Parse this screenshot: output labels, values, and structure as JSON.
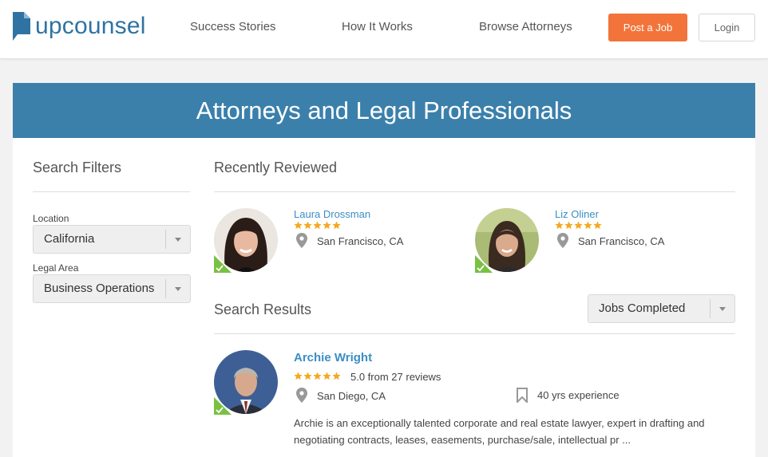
{
  "brand": {
    "name": "upcounsel",
    "color": "#2f73a2",
    "accent": "#f2743b"
  },
  "nav": {
    "links": [
      "Success Stories",
      "How It Works",
      "Browse Attorneys"
    ],
    "post_job": "Post a Job",
    "login": "Login"
  },
  "banner": {
    "title": "Attorneys and Legal Professionals",
    "color": "#3b80ab"
  },
  "filters": {
    "title": "Search Filters",
    "location_label": "Location",
    "location_value": "California",
    "legal_area_label": "Legal Area",
    "legal_area_value": "Business Operations"
  },
  "recently_reviewed": {
    "title": "Recently Reviewed",
    "people": [
      {
        "name": "Laura Drossman",
        "rating": 5,
        "location": "San Francisco, CA"
      },
      {
        "name": "Liz Oliner",
        "rating": 5,
        "location": "San Francisco, CA"
      }
    ]
  },
  "results": {
    "title": "Search Results",
    "sort_value": "Jobs Completed",
    "items": [
      {
        "name": "Archie Wright",
        "rating": 5,
        "reviews": "5.0 from 27 reviews",
        "location": "San Diego, CA",
        "experience": "40 yrs experience",
        "description": "Archie is an exceptionally talented corporate and real estate lawyer, expert in drafting and negotiating contracts, leases, easements, purchase/sale, intellectual pr ..."
      }
    ]
  },
  "icons": [
    "logo-icon",
    "star-icon",
    "location-pin-icon",
    "bookmark-icon",
    "verified-check-icon",
    "chevron-down-icon"
  ]
}
